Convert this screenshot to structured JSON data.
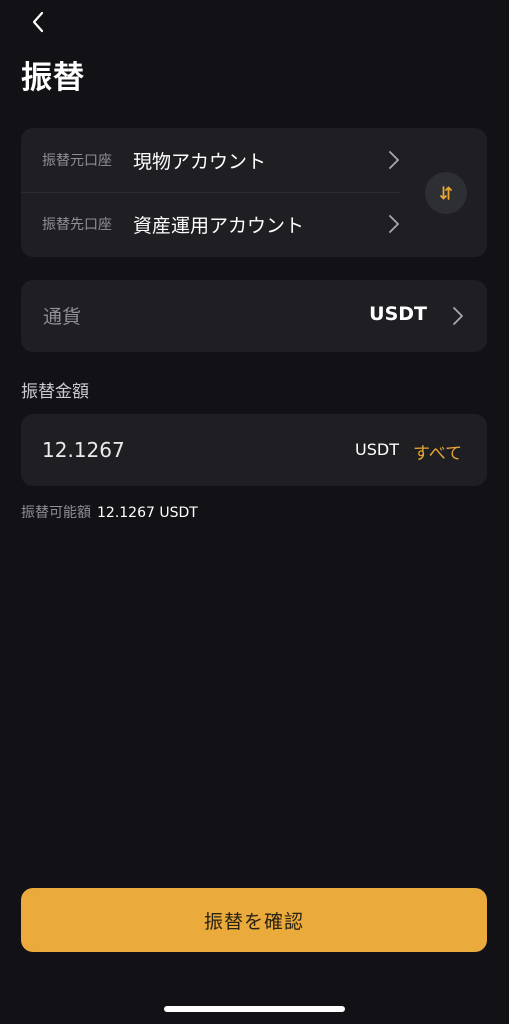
{
  "header": {
    "title": "振替"
  },
  "accounts": {
    "from_label": "振替元口座",
    "from_value": "現物アカウント",
    "to_label": "振替先口座",
    "to_value": "資産運用アカウント"
  },
  "currency": {
    "label": "通貨",
    "value": "USDT"
  },
  "amount": {
    "title": "振替金額",
    "value": "12.1267",
    "unit": "USDT",
    "max_label": "すべて"
  },
  "available": {
    "label": "振替可能額",
    "value": "12.1267 USDT"
  },
  "confirm": {
    "label": "振替を確認"
  },
  "icons": {
    "back": "chevron-left-icon",
    "swap": "swap-vertical-icon",
    "row_arrow": "chevron-right-icon"
  },
  "colors": {
    "background": "#121115",
    "card": "#1e1e23",
    "accent": "#e8a635",
    "button": "#ebaa3c"
  }
}
